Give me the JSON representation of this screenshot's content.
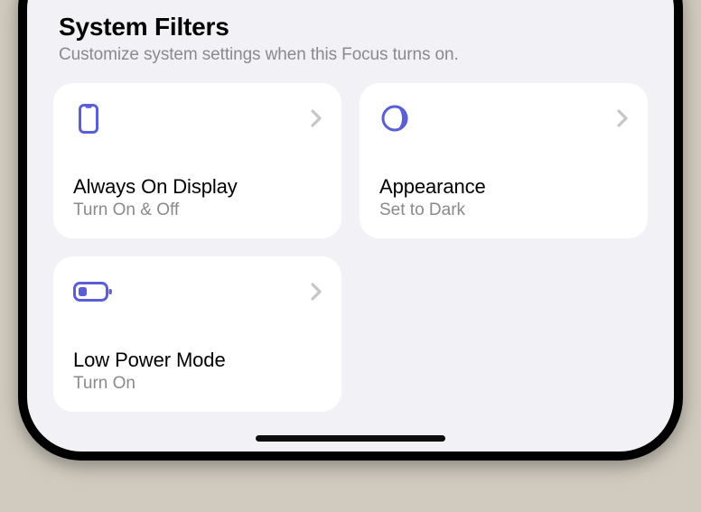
{
  "colors": {
    "accent": "#5a5fd6",
    "chevron": "#c6c6c8"
  },
  "section": {
    "title": "System Filters",
    "subtitle": "Customize system settings when this Focus turns on."
  },
  "cards": [
    {
      "icon": "phone-icon",
      "title": "Always On Display",
      "subtitle": "Turn On & Off"
    },
    {
      "icon": "halfmoon-icon",
      "title": "Appearance",
      "subtitle": "Set to Dark"
    },
    {
      "icon": "battery-icon",
      "title": "Low Power Mode",
      "subtitle": "Turn On"
    }
  ]
}
